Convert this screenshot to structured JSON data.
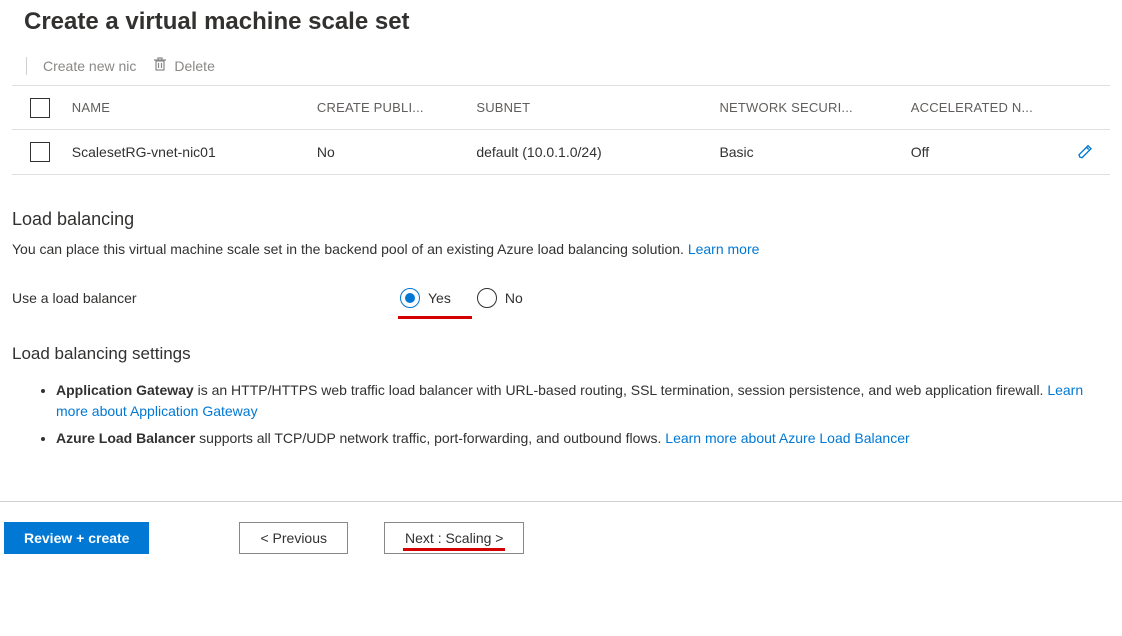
{
  "page": {
    "title": "Create a virtual machine scale set"
  },
  "toolbar": {
    "create_nic": "Create new nic",
    "delete": "Delete"
  },
  "table": {
    "headers": {
      "name": "NAME",
      "create_publi": "CREATE PUBLI...",
      "subnet": "SUBNET",
      "network_securi": "NETWORK SECURI...",
      "accelerated_n": "ACCELERATED N..."
    },
    "rows": [
      {
        "name": "ScalesetRG-vnet-nic01",
        "create_publi": "No",
        "subnet": "default (10.0.1.0/24)",
        "nsg": "Basic",
        "accel": "Off"
      }
    ]
  },
  "load_balancing": {
    "title": "Load balancing",
    "desc": "You can place this virtual machine scale set in the backend pool of an existing Azure load balancing solution.  ",
    "learn_more": "Learn more",
    "use_label": "Use a load balancer",
    "yes": "Yes",
    "no": "No"
  },
  "lb_settings": {
    "title": "Load balancing settings",
    "app_gateway_name": "Application Gateway",
    "app_gateway_text": " is an HTTP/HTTPS web traffic load balancer with URL-based routing, SSL termination, session persistence, and web application firewall.  ",
    "app_gateway_link": "Learn more about Application Gateway",
    "azure_lb_name": "Azure Load Balancer",
    "azure_lb_text": " supports all TCP/UDP network traffic, port-forwarding, and outbound flows.  ",
    "azure_lb_link": "Learn more about Azure Load Balancer"
  },
  "footer": {
    "review": "Review + create",
    "previous": "< Previous",
    "next": "Next : Scaling >"
  }
}
